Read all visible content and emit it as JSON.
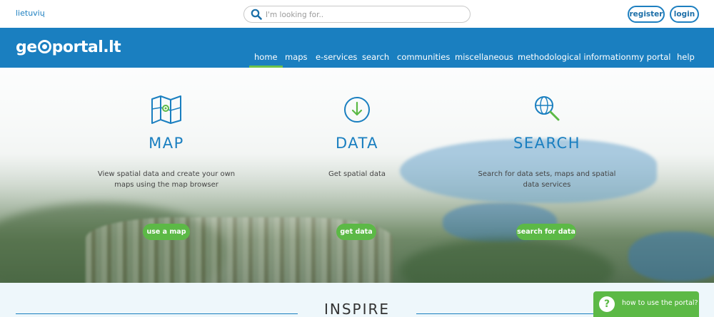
{
  "topbar": {
    "language_link": "lietuvių",
    "search_placeholder": "I'm looking for..",
    "register_label": "register",
    "login_label": "login"
  },
  "header": {
    "logo_text_left": "ge",
    "logo_text_right": "portal.lt",
    "nav": [
      {
        "label": "home",
        "active": true
      },
      {
        "label": "maps"
      },
      {
        "label": "e-services"
      },
      {
        "label": "search"
      },
      {
        "label": "communities"
      },
      {
        "label": "miscellaneous"
      },
      {
        "label": "methodological information"
      },
      {
        "label": "my portal"
      },
      {
        "label": "help"
      }
    ]
  },
  "hero": {
    "map": {
      "icon": "map-icon",
      "title": "MAP",
      "text": "View spatial data and create your own maps using the map browser",
      "button": "use a map"
    },
    "data": {
      "icon": "download-icon",
      "title": "DATA",
      "text": "Get spatial data",
      "button": "get data"
    },
    "search": {
      "icon": "globe-search-icon",
      "title": "SEARCH",
      "text": "Search for data sets, maps and spatial data services",
      "button": "search for data"
    }
  },
  "section": {
    "title": "INSPIRE"
  },
  "help_widget": {
    "icon": "question-icon",
    "symbol": "?",
    "label": "how to use the portal?"
  },
  "colors": {
    "brand_blue": "#1a7fc0",
    "accent_green": "#5cb946"
  }
}
